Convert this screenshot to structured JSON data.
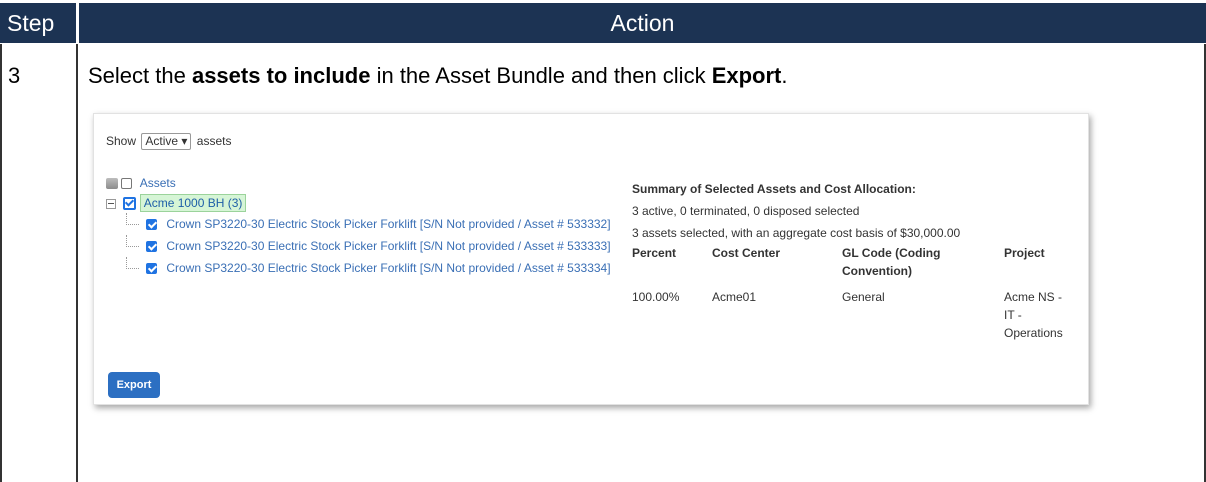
{
  "table": {
    "header_step": "Step",
    "header_action": "Action",
    "step_number": "3",
    "instruction": {
      "part1": "Select the ",
      "bold1": "assets to include",
      "part2": " in the Asset Bundle and then click ",
      "bold2": "Export",
      "part3": "."
    }
  },
  "app": {
    "show": {
      "prefix": "Show",
      "selected": "Active",
      "suffix": "assets"
    },
    "tree": {
      "root_label": "Assets",
      "group_label": "Acme 1000 BH (3)",
      "children": [
        "Crown SP3220-30 Electric Stock Picker Forklift [S/N Not provided / Asset # 533332]",
        "Crown SP3220-30 Electric Stock Picker Forklift [S/N Not provided / Asset # 533333]",
        "Crown SP3220-30 Electric Stock Picker Forklift [S/N Not provided / Asset # 533334]"
      ]
    },
    "summary": {
      "title": "Summary of Selected Assets and Cost Allocation:",
      "status_line": "3 active, 0 terminated, 0 disposed selected",
      "basis_line": "3 assets selected, with an aggregate cost basis of $30,000.00",
      "headers": {
        "percent": "Percent",
        "cost_center": "Cost Center",
        "gl_code_1": "GL Code (Coding",
        "gl_code_2": "Convention)",
        "project": "Project"
      },
      "row": {
        "percent": "100.00%",
        "cost_center": "Acme01",
        "gl_code": "General",
        "project_1": "Acme NS -",
        "project_2": "IT -",
        "project_3": "Operations"
      }
    },
    "export_label": "Export"
  },
  "colors": {
    "header_bg": "#1c3353",
    "link": "#3a6fb5",
    "button": "#2c6fc2",
    "selection_highlight": "#d6f5d6"
  }
}
